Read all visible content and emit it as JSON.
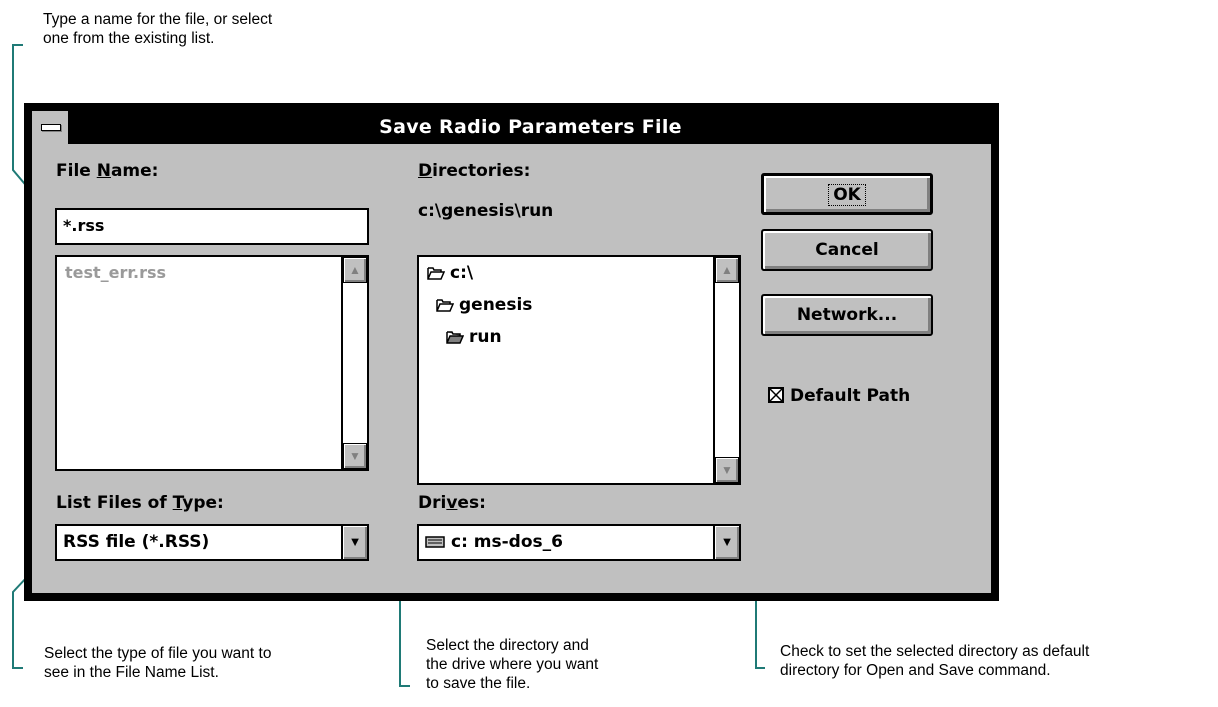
{
  "callouts": {
    "top": "Type a name for the file, or select\none from the existing list.",
    "bottom_left": "Select the type of file you want to\nsee in the File Name List.",
    "bottom_mid": "Select the directory and\nthe drive where you want\nto save the file.",
    "bottom_right": "Check to set the selected directory as default\ndirectory for Open and Save command."
  },
  "window": {
    "title": "Save Radio Parameters File"
  },
  "file_name": {
    "label_pre": "File ",
    "label_ul": "N",
    "label_post": "ame:",
    "value": "*.rss",
    "list": [
      "test_err.rss"
    ]
  },
  "file_type": {
    "label_pre": "List Files of ",
    "label_ul": "T",
    "label_post": "ype:",
    "selected": "RSS file (*.RSS)"
  },
  "directories": {
    "label_ul": "D",
    "label_post": "irectories:",
    "current_path": "c:\\genesis\\run",
    "items": [
      "c:\\",
      "genesis",
      "run"
    ]
  },
  "drives": {
    "label_pre": "Dri",
    "label_ul": "v",
    "label_post": "es:",
    "selected": "c: ms-dos_6"
  },
  "buttons": {
    "ok": "OK",
    "cancel": "Cancel",
    "network": "Network..."
  },
  "default_path": {
    "label": "Default Path",
    "checked": true
  },
  "icons": {
    "scroll_up": "▲",
    "scroll_down": "▼",
    "dropdown": "▼"
  },
  "colors": {
    "leader": "#1f7a76",
    "dialog_face": "#c0c0c0",
    "title_bar": "#000000",
    "disabled_text": "#9a9a9a"
  }
}
